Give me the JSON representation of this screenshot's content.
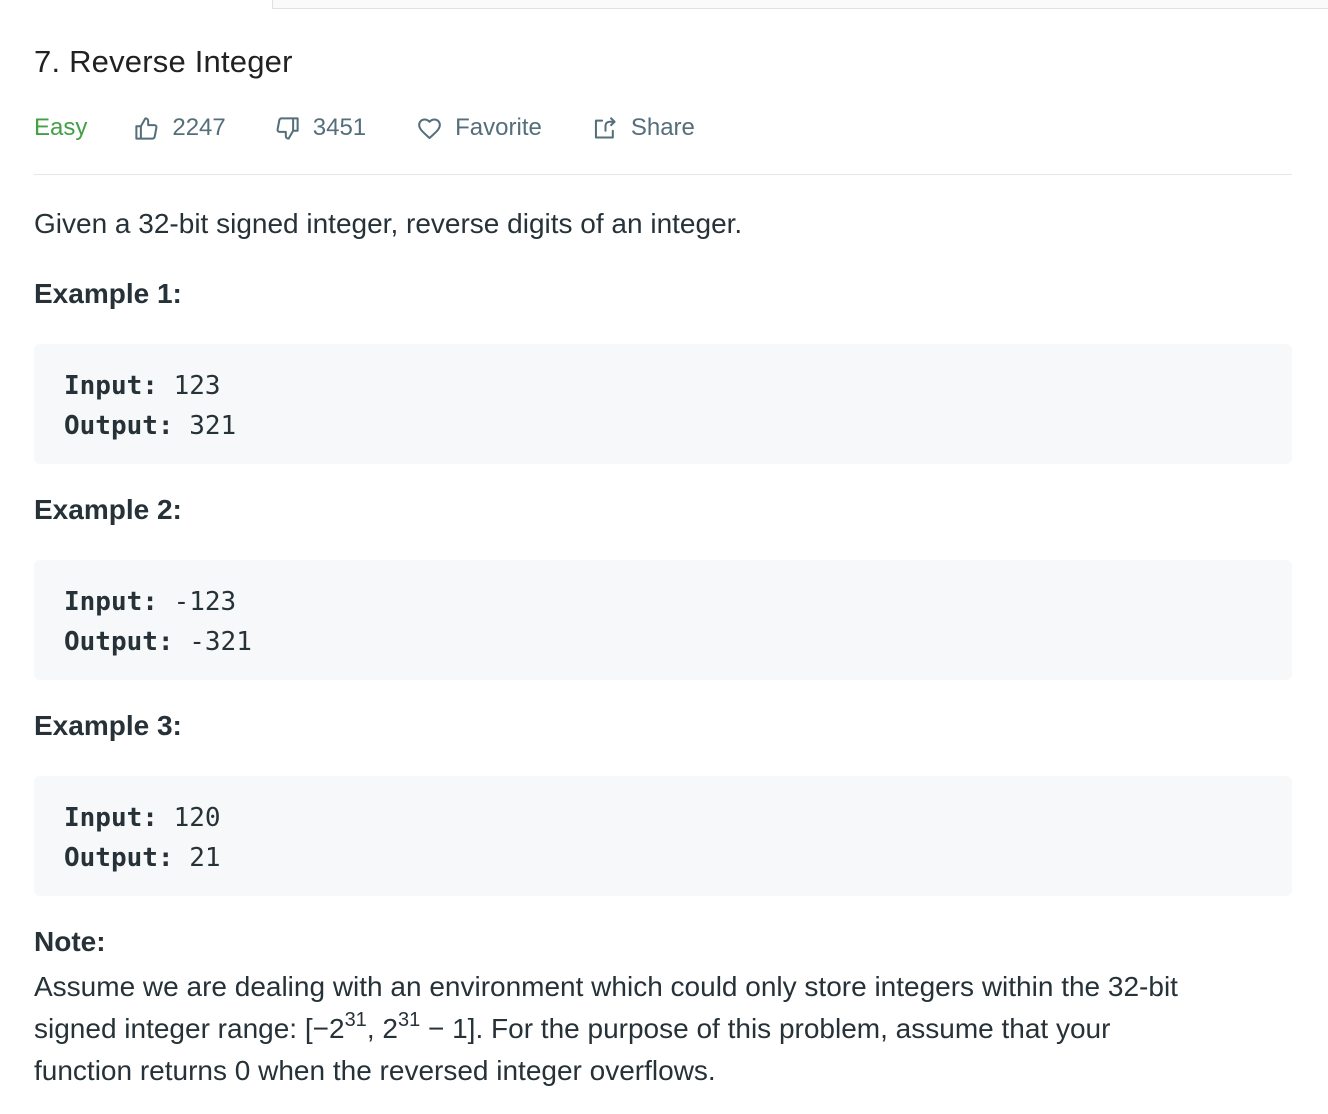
{
  "problem": {
    "title": "7. Reverse Integer",
    "difficulty": "Easy",
    "likes": "2247",
    "dislikes": "3451",
    "favorite_label": "Favorite",
    "share_label": "Share",
    "description": "Given a 32-bit signed integer, reverse digits of an integer."
  },
  "colors": {
    "difficulty_easy": "#43a047",
    "meta_text": "#546e7a",
    "code_bg": "#f7f8fa"
  },
  "examples": [
    {
      "title": "Example 1:",
      "input_label": "Input:",
      "input_value": " 123",
      "output_label": "Output:",
      "output_value": " 321"
    },
    {
      "title": "Example 2:",
      "input_label": "Input:",
      "input_value": " -123",
      "output_label": "Output:",
      "output_value": " -321"
    },
    {
      "title": "Example 3:",
      "input_label": "Input:",
      "input_value": " 120",
      "output_label": "Output:",
      "output_value": " 21"
    }
  ],
  "note": {
    "title": "Note:",
    "line1": "Assume we are dealing with an environment which could only store integers within the 32-bit",
    "line2_prefix": "signed integer range: [−2",
    "line2_exp1": "31",
    "line2_mid": ",  2",
    "line2_exp2": "31",
    "line2_suffix": " − 1]. For the purpose of this problem, assume that your",
    "line3": "function returns 0 when the reversed integer overflows."
  },
  "icons": {
    "like": "thumbs-up-icon",
    "dislike": "thumbs-down-icon",
    "favorite": "heart-icon",
    "share": "share-icon"
  }
}
